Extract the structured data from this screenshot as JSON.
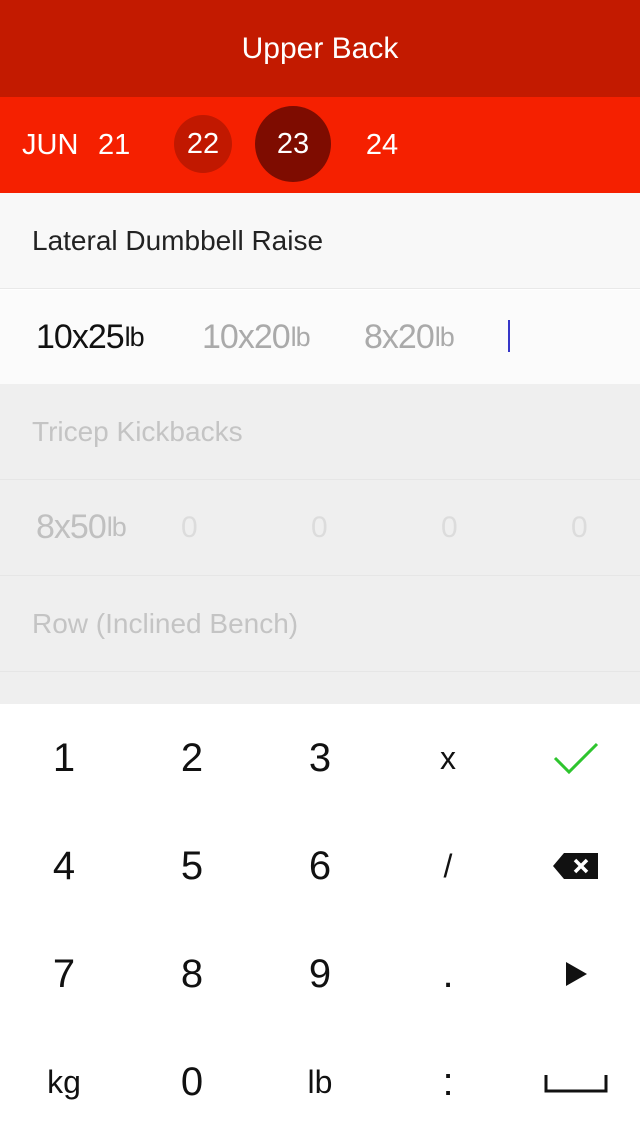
{
  "header": {
    "title": "Upper Back"
  },
  "dates": {
    "month": "JUN",
    "days": [
      {
        "label": "21"
      },
      {
        "label": "22"
      },
      {
        "label": "23"
      },
      {
        "label": "24"
      }
    ]
  },
  "workout": {
    "active_exercise": "Lateral Dumbbell Raise",
    "active_sets": [
      {
        "reps_weight": "10x25",
        "unit": "lb"
      },
      {
        "reps_weight": "10x20",
        "unit": "lb"
      },
      {
        "reps_weight": "8x20",
        "unit": "lb"
      }
    ],
    "exercises": [
      {
        "name": "Tricep Kickbacks"
      },
      {
        "name": "Row (Inclined Bench)"
      }
    ],
    "tricep_sets": [
      {
        "reps_weight": "8x50",
        "unit": "lb"
      }
    ],
    "zeros": [
      "0",
      "0",
      "0",
      "0"
    ]
  },
  "keyboard": {
    "keys": [
      "1",
      "2",
      "3",
      "x",
      "4",
      "5",
      "6",
      "/",
      "7",
      "8",
      "9",
      ".",
      "kg",
      "0",
      "lb",
      ":"
    ],
    "icons": [
      "check-icon",
      "backspace-icon",
      "next-icon",
      "space-icon"
    ],
    "accent_check_color": "#2ec52e"
  }
}
